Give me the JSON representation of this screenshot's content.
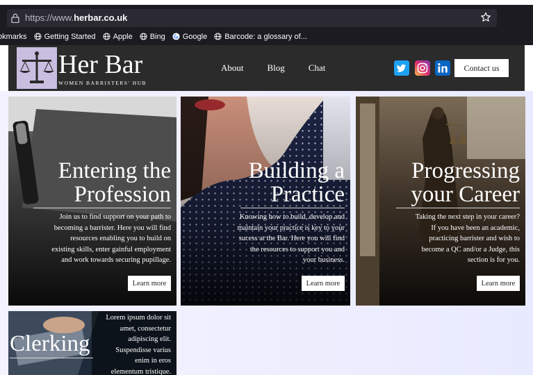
{
  "browser": {
    "url_prefix": "https://www.",
    "url_domain": "herbar.co.uk",
    "bookmarks": [
      {
        "label": "okmarks"
      },
      {
        "label": "Getting Started",
        "icon": "globe-icon"
      },
      {
        "label": "Apple",
        "icon": "globe-icon"
      },
      {
        "label": "Bing",
        "icon": "globe-icon"
      },
      {
        "label": "Google",
        "icon": "google-icon"
      },
      {
        "label": "Barcode: a glossary of...",
        "icon": "globe-icon"
      }
    ]
  },
  "header": {
    "brand": "Her Bar",
    "tagline": "WOMEN BARRISTERS' HUB",
    "nav": [
      "About",
      "Blog",
      "Chat"
    ],
    "contact_label": "Contact us",
    "social": [
      "twitter-icon",
      "instagram-icon",
      "linkedin-icon"
    ],
    "colors": {
      "twitter": "#1da1f2",
      "instagram": "#d6249f",
      "linkedin": "#0a66c2",
      "header_bg": "#2b2b2b"
    }
  },
  "cards": [
    {
      "title_line1": "Entering the",
      "title_line2": "Profession",
      "text_lines": [
        "Join us to find support on your path to",
        "becoming a barrister. Here you will find",
        "resources enabling you to build on",
        "existing skills, enter gainful employment",
        "and work towards securing pupillage."
      ],
      "button": "Learn more"
    },
    {
      "title_line1": "Building a",
      "title_line2": "Practice",
      "text_lines": [
        "Knowing how to build, develop and",
        "maintain your practice is key to your",
        "sucess at the Bar. Here you will find",
        "the resources to support you and",
        "your business."
      ],
      "button": "Learn more"
    },
    {
      "title_line1": "Progressing",
      "title_line2": "your Career",
      "text_lines": [
        "Taking the next step in your career?",
        "If you have been an academic,",
        "practicing barrister and wish to",
        "become a QC and/or a Judge, this",
        "section is for you."
      ],
      "button": "Learn more"
    },
    {
      "title_line1": "Clerking",
      "text_lines": [
        "Lorem ipsum dolor sit",
        "amet, consectetur",
        "adipiscing elit.",
        "Suspendisse varius",
        "enim in eros",
        "elementum tristique."
      ]
    }
  ]
}
